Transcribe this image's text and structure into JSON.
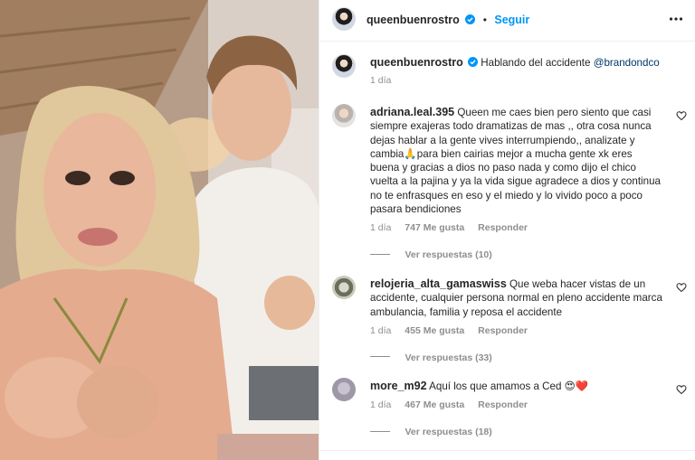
{
  "post": {
    "author": "queenbuenrostro",
    "follow_label": "Seguir",
    "dot": "•",
    "caption_text": "Hablando del accidente",
    "caption_mention": "@brandondco",
    "caption_time": "1 día"
  },
  "comments": [
    {
      "username": "adriana.leal.395",
      "text": "Queen me caes bien pero siento que casi siempre exajeras todo dramatizas de mas ,, otra cosa nunca dejas hablar a la gente vives interrumpiendo,, analizate y cambia🙏para bien cairias mejor a mucha gente xk eres buena y gracias a dios no paso nada y como dijo el chico vuelta a la pajina y ya la vida sigue agradece a dios y continua no te enfrasques en eso y el miedo y lo vivido poco a poco pasara bendiciones",
      "time": "1 día",
      "likes": "747 Me gusta",
      "reply": "Responder",
      "view_replies": "Ver respuestas (10)"
    },
    {
      "username": "relojeria_alta_gamaswiss",
      "text": "Que weba hacer vistas de un accidente, cualquier persona normal en pleno accidente marca ambulancia, familia y reposa el accidente",
      "time": "1 día",
      "likes": "455 Me gusta",
      "reply": "Responder",
      "view_replies": "Ver respuestas (33)"
    },
    {
      "username": "more_m92",
      "text": "Aquí los que amamos a Ced 😍❤️",
      "time": "1 día",
      "likes": "467 Me gusta",
      "reply": "Responder",
      "view_replies": "Ver respuestas (18)"
    }
  ],
  "colors": {
    "link_blue": "#0095f6",
    "verified_blue": "#0095f6",
    "muted_text": "#8e8e8e"
  },
  "icons": [
    "verified-icon",
    "more-options-icon",
    "heart-icon"
  ]
}
